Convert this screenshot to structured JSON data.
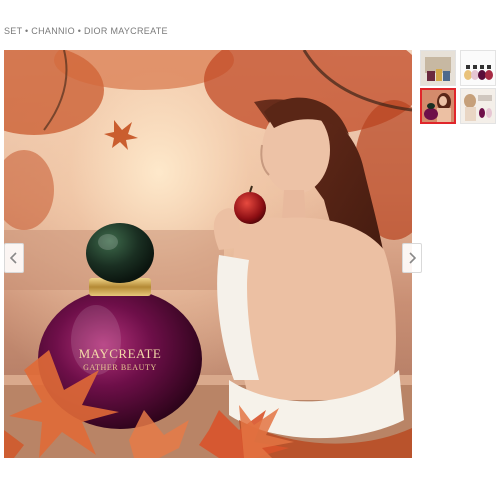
{
  "page": {
    "caption": "SET • CHANNIO • DIOR MAYCREATE"
  },
  "gallery": {
    "current_index": 1,
    "thumbnail_count": 4,
    "main_image_alt": "Woman holding a red apple beside a MAYCREATE perfume bottle with autumn maple leaves",
    "bottle_brand": "MAYCREATE",
    "bottle_tagline": "GATHER BEAUTY",
    "prev_icon": "chevron-left-icon",
    "next_icon": "chevron-right-icon",
    "thumbnails": [
      {
        "alt": "Perfume set thumbnail"
      },
      {
        "alt": "Four perfume bottles thumbnail"
      },
      {
        "alt": "Woman with perfume thumbnail"
      },
      {
        "alt": "Woman and bottles thumbnail"
      }
    ]
  },
  "colors": {
    "active_thumbnail_border": "#e0262b",
    "bottle_purple": "#5a0d3a",
    "leaf_orange": "#d9532b"
  }
}
